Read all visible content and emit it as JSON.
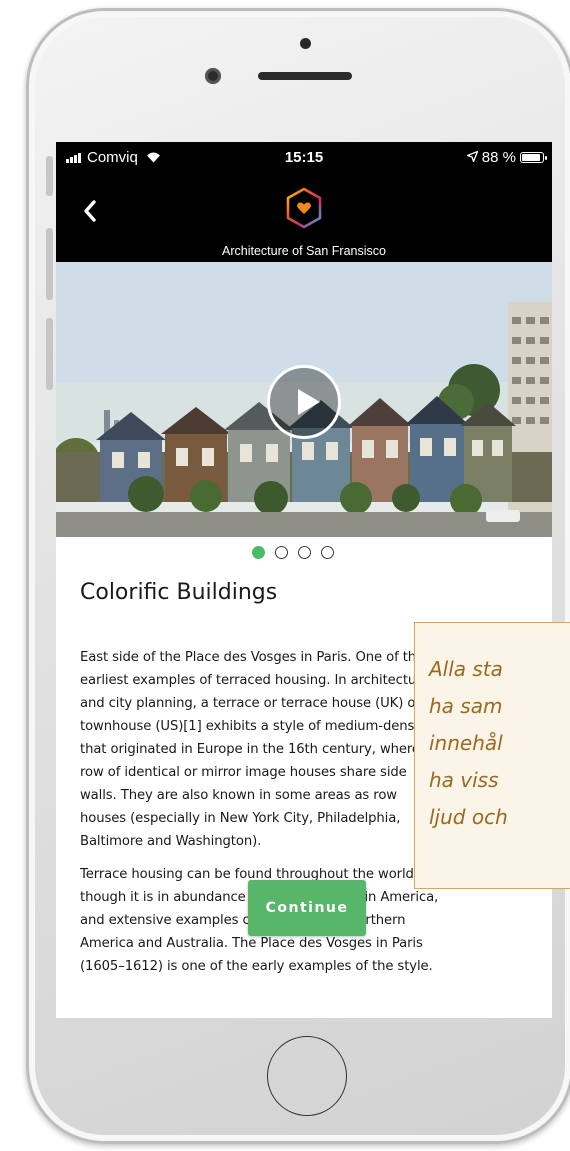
{
  "status_bar": {
    "carrier": "Comviq",
    "time": "15:15",
    "battery": "88 %"
  },
  "nav": {
    "title": "Architecture of San Fransisco"
  },
  "carousel": {
    "total": 4,
    "active": 1
  },
  "article": {
    "heading": "Colorific Buildings",
    "paragraphs": [
      [
        "East side of the Place des Vosges in Paris. One of the",
        "earliest examples of terraced housing. In architecture",
        "and city planning, a terrace or terrace house (UK) or",
        "townhouse (US)[1] exhibits a style of medium-density housing",
        "that originated in Europe in the 16th century, where a",
        "row of identical or mirror image houses share side",
        "walls. They are also known in some areas as row",
        "houses (especially in New York City, Philadelphia,",
        "Baltimore and Washington)."
      ],
      [
        "Terrace housing can be found throughout the world,",
        "though it is in abundance in Europe and Latin America,",
        "and extensive examples can be found in Northern",
        "America and Australia. The Place des Vosges in Paris",
        "(1605–1612) is one of the early examples of the style."
      ]
    ]
  },
  "buttons": {
    "continue": "Continue"
  },
  "overlay_note": {
    "lines": [
      "Alla sta",
      "ha sam",
      "innehål",
      "ha viss",
      "ljud och"
    ]
  },
  "colors": {
    "accent_green": "#4cba6b",
    "note_border": "#e8a24a",
    "note_text": "#9a6a1e"
  }
}
